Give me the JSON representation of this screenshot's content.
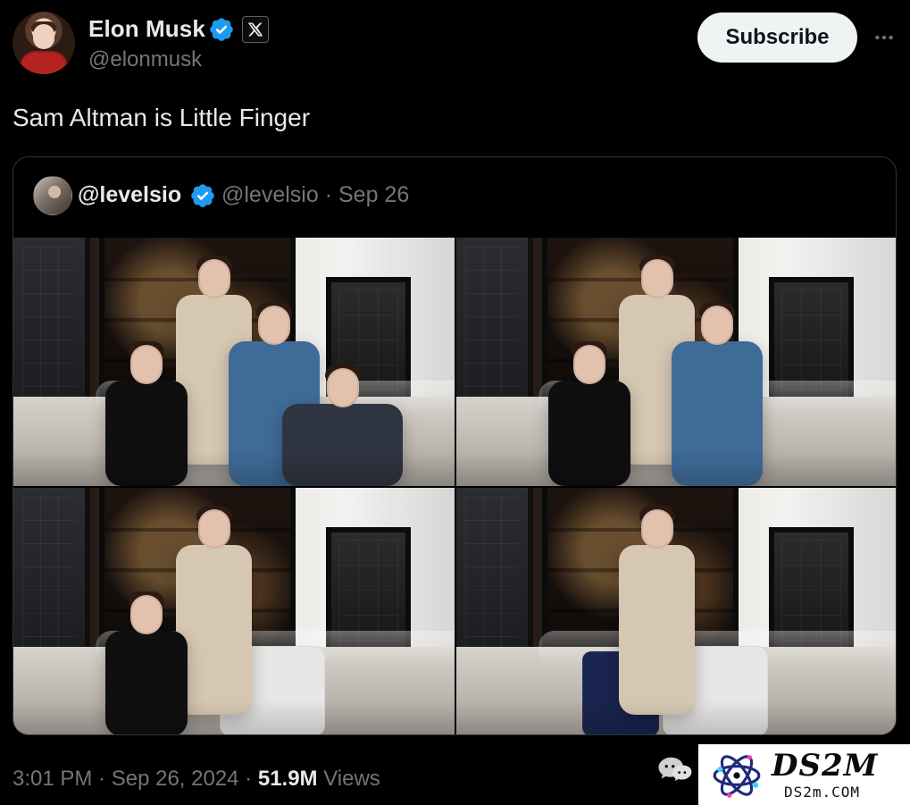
{
  "header": {
    "display_name": "Elon Musk",
    "handle": "@elonmusk",
    "subscribe_label": "Subscribe",
    "more_icon": "more-horizontal-icon"
  },
  "tweet": {
    "text": "Sam Altman is Little Finger"
  },
  "quote": {
    "author_display": "@levelsio",
    "author_handle": "@levelsio",
    "date": "Sep 26",
    "meta_sep": " · "
  },
  "footer": {
    "time": "3:01 PM",
    "sep": " · ",
    "date": "Sep 26, 2024",
    "views_count": "51.9M",
    "views_label": "Views"
  },
  "watermark": {
    "brand_big": "DS2M",
    "brand_small": "DS2m.COM"
  },
  "colors": {
    "bg": "#000000",
    "text_primary": "#e7e9ea",
    "text_secondary": "#71767b",
    "border": "#2f3336",
    "verified_blue": "#1d9bf0",
    "subscribe_bg": "#eff3f4"
  }
}
